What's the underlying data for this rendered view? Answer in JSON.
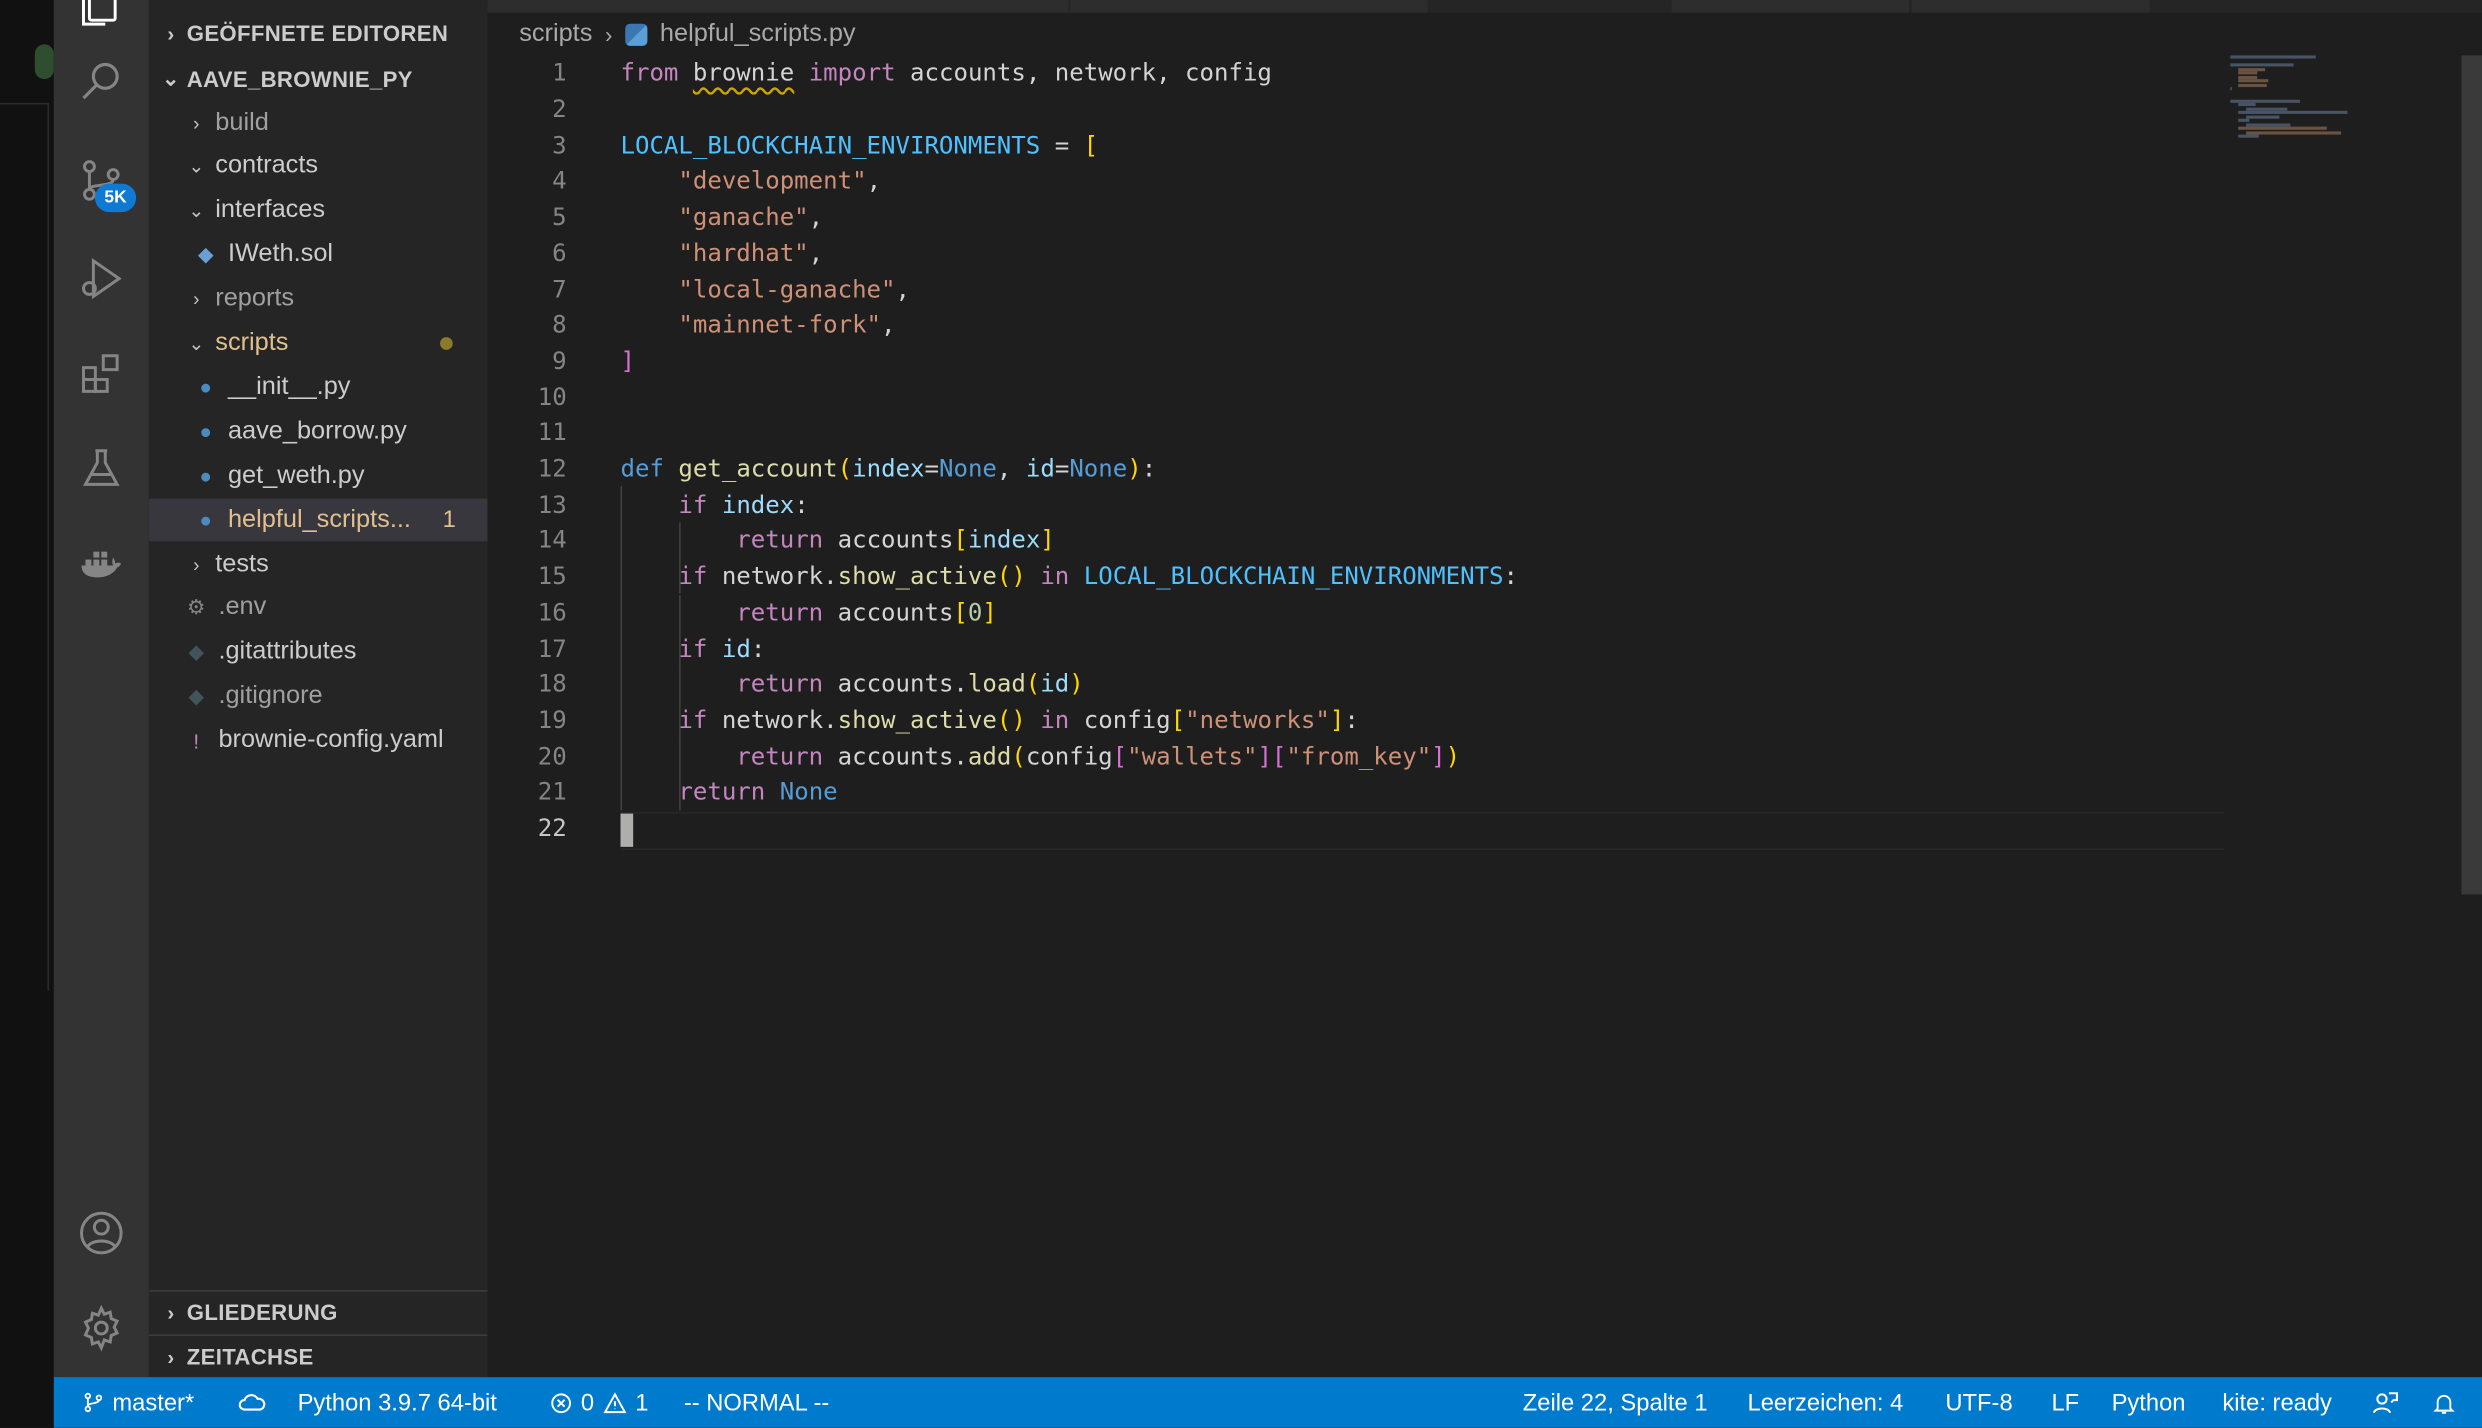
{
  "sidebar": {
    "open_editors_header": "GEÖFFNETE EDITOREN",
    "project_header": "AAVE_BROWNIE_PY",
    "tree": [
      {
        "label": "build",
        "kind": "folder",
        "expanded": false,
        "depth": 1
      },
      {
        "label": "contracts",
        "kind": "folder",
        "expanded": true,
        "depth": 1
      },
      {
        "label": "interfaces",
        "kind": "folder",
        "expanded": true,
        "depth": 1
      },
      {
        "label": "IWeth.sol",
        "kind": "sol",
        "depth": 2
      },
      {
        "label": "reports",
        "kind": "folder",
        "expanded": false,
        "depth": 1
      },
      {
        "label": "scripts",
        "kind": "folder",
        "expanded": true,
        "depth": 1
      },
      {
        "label": "__init__.py",
        "kind": "py",
        "depth": 2
      },
      {
        "label": "aave_borrow.py",
        "kind": "py",
        "depth": 2
      },
      {
        "label": "get_weth.py",
        "kind": "py",
        "depth": 2
      },
      {
        "label": "helpful_scripts...",
        "kind": "py",
        "depth": 2,
        "badge": "1"
      },
      {
        "label": "tests",
        "kind": "folder",
        "expanded": false,
        "depth": 1
      },
      {
        "label": ".env",
        "kind": "gear",
        "depth": 1
      },
      {
        "label": ".gitattributes",
        "kind": "git",
        "depth": 1
      },
      {
        "label": ".gitignore",
        "kind": "git",
        "depth": 1
      },
      {
        "label": "brownie-config.yaml",
        "kind": "yaml",
        "depth": 1
      }
    ],
    "outline_header": "GLIEDERUNG",
    "timeline_header": "ZEITACHSE"
  },
  "activity": {
    "scm_badge": "5K"
  },
  "editor": {
    "breadcrumb_folder": "scripts",
    "breadcrumb_file": "helpful_scripts.py",
    "current_line": 22,
    "lines": [
      "from brownie import accounts, network, config",
      "",
      "LOCAL_BLOCKCHAIN_ENVIRONMENTS = [",
      "    \"development\",",
      "    \"ganache\",",
      "    \"hardhat\",",
      "    \"local-ganache\",",
      "    \"mainnet-fork\",",
      "]",
      "",
      "",
      "def get_account(index=None, id=None):",
      "    if index:",
      "        return accounts[index]",
      "    if network.show_active() in LOCAL_BLOCKCHAIN_ENVIRONMENTS:",
      "        return accounts[0]",
      "    if id:",
      "        return accounts.load(id)",
      "    if network.show_active() in config[\"networks\"]:",
      "        return accounts.add(config[\"wallets\"][\"from_key\"])",
      "    return None",
      ""
    ]
  },
  "status": {
    "branch": "master*",
    "python": "Python 3.9.7 64-bit",
    "errors": "0",
    "warnings": "1",
    "mode": "-- NORMAL --",
    "position": "Zeile 22, Spalte 1",
    "spaces": "Leerzeichen: 4",
    "encoding": "UTF-8",
    "eol": "LF",
    "language": "Python",
    "kite": "kite: ready"
  }
}
